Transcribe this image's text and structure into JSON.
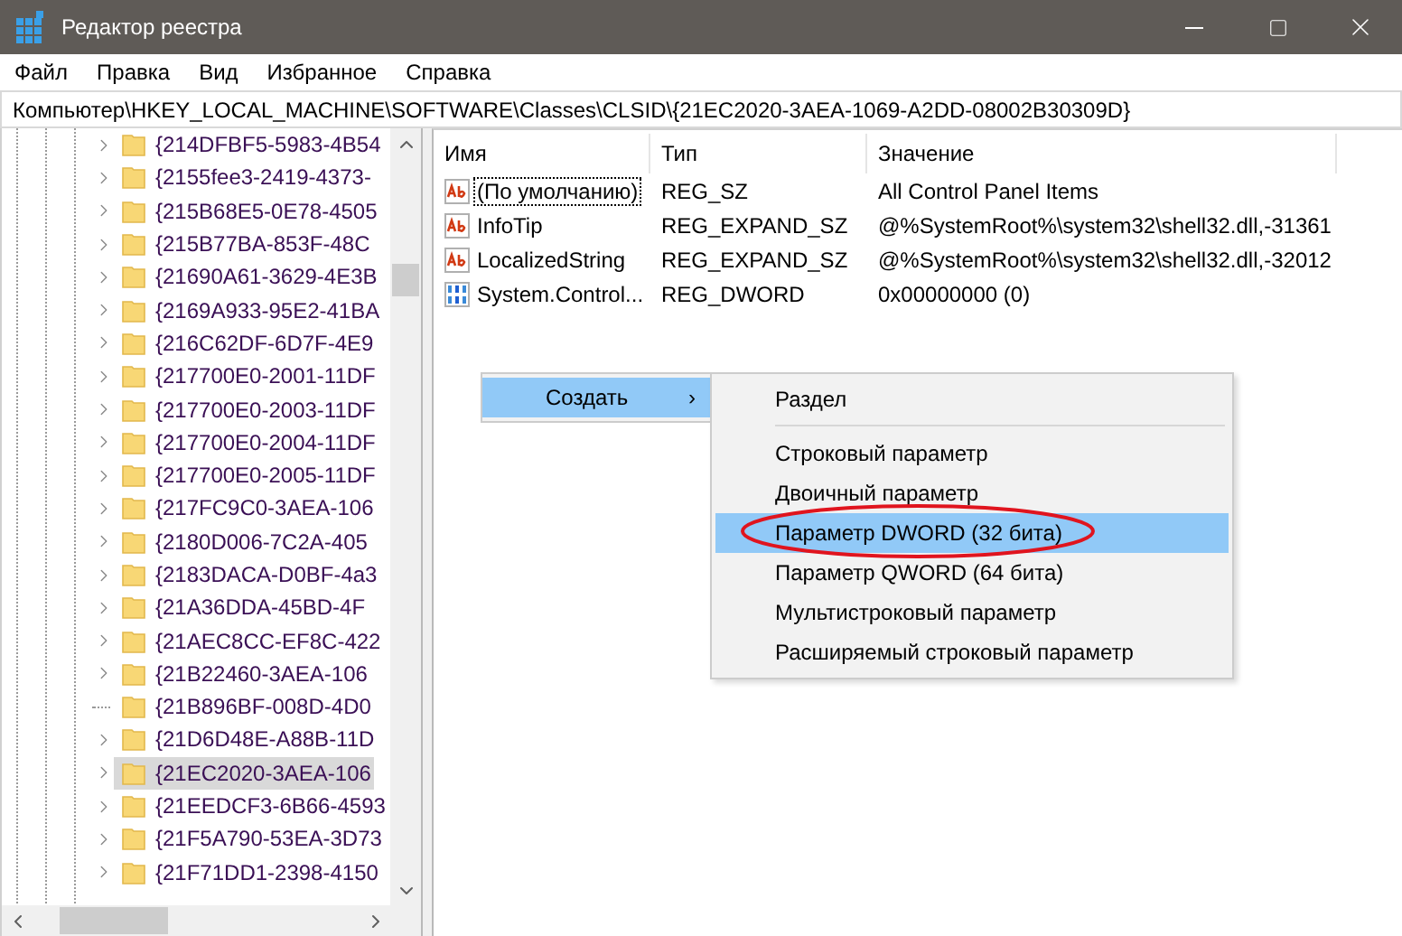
{
  "window": {
    "title": "Редактор реестра"
  },
  "menu": [
    "Файл",
    "Правка",
    "Вид",
    "Избранное",
    "Справка"
  ],
  "address": "Компьютер\\HKEY_LOCAL_MACHINE\\SOFTWARE\\Classes\\CLSID\\{21EC2020-3AEA-1069-A2DD-08002B30309D}",
  "tree": {
    "items": [
      {
        "label": "{214DFBF5-5983-4B54",
        "kind": "folder",
        "selected": false
      },
      {
        "label": "{2155fee3-2419-4373-",
        "kind": "folder",
        "selected": false
      },
      {
        "label": "{215B68E5-0E78-4505",
        "kind": "folder",
        "selected": false
      },
      {
        "label": "{215B77BA-853F-48C",
        "kind": "folder",
        "selected": false
      },
      {
        "label": "{21690A61-3629-4E3B",
        "kind": "folder",
        "selected": false
      },
      {
        "label": "{2169A933-95E2-41BA",
        "kind": "folder",
        "selected": false
      },
      {
        "label": "{216C62DF-6D7F-4E9",
        "kind": "folder",
        "selected": false
      },
      {
        "label": "{217700E0-2001-11DF",
        "kind": "folder",
        "selected": false
      },
      {
        "label": "{217700E0-2003-11DF",
        "kind": "folder",
        "selected": false
      },
      {
        "label": "{217700E0-2004-11DF",
        "kind": "folder",
        "selected": false
      },
      {
        "label": "{217700E0-2005-11DF",
        "kind": "folder",
        "selected": false
      },
      {
        "label": "{217FC9C0-3AEA-106",
        "kind": "folder",
        "selected": false
      },
      {
        "label": "{2180D006-7C2A-405",
        "kind": "folder",
        "selected": false
      },
      {
        "label": "{2183DACA-D0BF-4a3",
        "kind": "folder",
        "selected": false
      },
      {
        "label": "{21A36DDA-45BD-4F",
        "kind": "folder",
        "selected": false
      },
      {
        "label": "{21AEC8CC-EF8C-422",
        "kind": "folder",
        "selected": false
      },
      {
        "label": "{21B22460-3AEA-106",
        "kind": "folder",
        "selected": false
      },
      {
        "label": "{21B896BF-008D-4D0",
        "kind": "leaf",
        "selected": false
      },
      {
        "label": "{21D6D48E-A88B-11D",
        "kind": "folder",
        "selected": false
      },
      {
        "label": "{21EC2020-3AEA-106",
        "kind": "folder",
        "selected": true
      },
      {
        "label": "{21EEDCF3-6B66-4593",
        "kind": "folder",
        "selected": false
      },
      {
        "label": "{21F5A790-53EA-3D73",
        "kind": "folder",
        "selected": false
      },
      {
        "label": "{21F71DD1-2398-4150",
        "kind": "folder",
        "selected": false
      }
    ]
  },
  "values": {
    "columns": [
      "Имя",
      "Тип",
      "Значение"
    ],
    "rows": [
      {
        "name": "(По умолчанию)",
        "type": "REG_SZ",
        "value": "All Control Panel Items",
        "kind": "string",
        "focused": true
      },
      {
        "name": "InfoTip",
        "type": "REG_EXPAND_SZ",
        "value": "@%SystemRoot%\\system32\\shell32.dll,-31361",
        "kind": "string",
        "focused": false
      },
      {
        "name": "LocalizedString",
        "type": "REG_EXPAND_SZ",
        "value": "@%SystemRoot%\\system32\\shell32.dll,-32012",
        "kind": "string",
        "focused": false
      },
      {
        "name": "System.Control...",
        "type": "REG_DWORD",
        "value": "0x00000000 (0)",
        "kind": "binary",
        "focused": false
      }
    ]
  },
  "context_menu": {
    "items": [
      {
        "label": "Создать",
        "selected": true,
        "has_submenu": true,
        "symbol": "›"
      }
    ]
  },
  "submenu": {
    "items": [
      {
        "label": "Раздел",
        "selected": false,
        "separator_after": true
      },
      {
        "label": "Строковый параметр",
        "selected": false,
        "separator_after": false
      },
      {
        "label": "Двоичный параметр",
        "selected": false,
        "separator_after": false
      },
      {
        "label": "Параметр DWORD (32 бита)",
        "selected": true,
        "separator_after": false
      },
      {
        "label": "Параметр QWORD (64 бита)",
        "selected": false,
        "separator_after": false
      },
      {
        "label": "Мультистроковый параметр",
        "selected": false,
        "separator_after": false
      },
      {
        "label": "Расширяемый строковый параметр",
        "selected": false,
        "separator_after": false
      }
    ]
  }
}
